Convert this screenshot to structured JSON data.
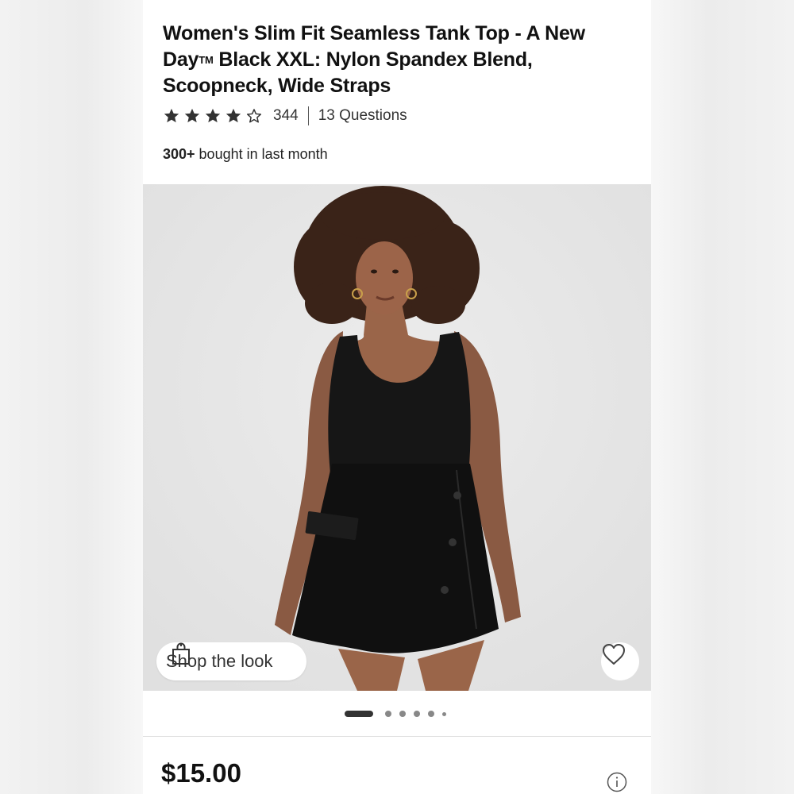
{
  "product": {
    "title_main": "Women's Slim Fit Seamless Tank Top - A New Day",
    "title_tm": "TM",
    "title_rest": " Black XXL: Nylon Spandex Blend, Scoopneck, Wide Straps",
    "rating": 4,
    "rating_max": 5,
    "rating_count": "344",
    "questions": "13 Questions",
    "bought_bold": "300+",
    "bought_rest": " bought in last month",
    "price": "$15.00"
  },
  "gallery": {
    "shop_the_look": "Shop the look",
    "current_image": 1,
    "image_count": 6
  },
  "icons": {
    "star_filled": "star-filled-icon",
    "star_empty": "star-outline-icon",
    "bag": "shopping-bag-icon",
    "heart": "heart-icon",
    "info": "info-icon"
  },
  "colors": {
    "text": "#111111",
    "star": "#333333",
    "image_bg": "#e6e6e6"
  }
}
